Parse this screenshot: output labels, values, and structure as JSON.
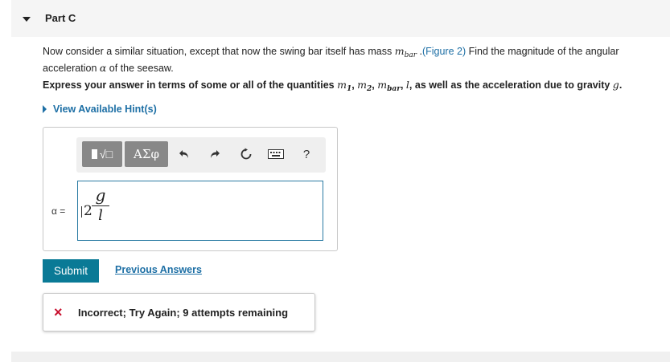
{
  "part": {
    "title": "Part C"
  },
  "problem": {
    "t1": "Now consider a similar situation, except that now the swing bar itself has mass ",
    "mbar_m": "m",
    "mbar_sub": "bar",
    "t2": " .",
    "figure_link": "(Figure 2)",
    "t3": " Find the magnitude of the angular acceleration ",
    "alpha": "α",
    "t4": " of the seesaw."
  },
  "express": {
    "t1": "Express your answer in terms of some or all of the quantities ",
    "m1": "m",
    "m1_sub": "1",
    "c1": ", ",
    "m2": "m",
    "m2_sub": "2",
    "c2": ", ",
    "mb": "m",
    "mb_sub": "bar",
    "c3": ", ",
    "l": "l",
    "t2": ", as well as the acceleration due to gravity ",
    "g": "g",
    "t3": "."
  },
  "hint": {
    "label": "View Available Hint(s)"
  },
  "toolbar": {
    "template_label": "√□",
    "greek_label": "ΑΣφ",
    "undo_icon": "undo-icon",
    "redo_icon": "redo-icon",
    "reset_icon": "reset-icon",
    "keyboard_icon": "keyboard-icon",
    "help_label": "?"
  },
  "answer": {
    "label": "α =",
    "coefficient": "2",
    "numerator": "g",
    "denominator": "l"
  },
  "submit_label": "Submit",
  "previous_answers_label": "Previous Answers",
  "feedback": {
    "icon": "×",
    "text": "Incorrect; Try Again; 9 attempts remaining"
  },
  "colors": {
    "link": "#1d6fa5",
    "submit_bg": "#0a7a96",
    "error": "#c8102e"
  }
}
